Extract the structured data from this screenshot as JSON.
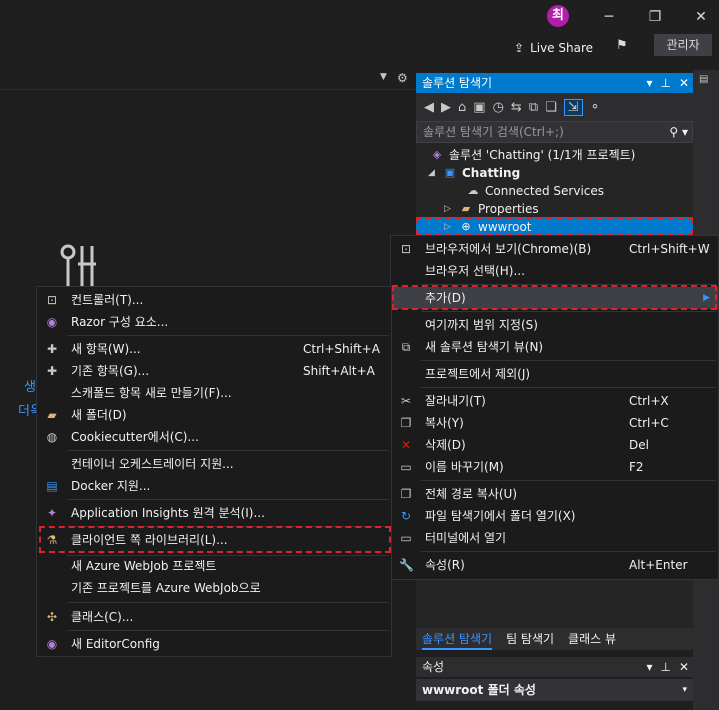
{
  "titlebar": {
    "avatar_initial": "최",
    "minimize": "─",
    "restore": "❐",
    "close": "✕",
    "live_share": "Live Share",
    "admin_button": "관리자"
  },
  "left_pane": {
    "blue_text_1": "생",
    "blue_text_2": "더욱"
  },
  "solution_explorer": {
    "title": "솔루션 탐색기",
    "search_placeholder": "솔루션 탐색기 검색(Ctrl+;)",
    "tree": {
      "solution": "솔루션 'Chatting' (1/1개 프로젝트)",
      "project": "Chatting",
      "connected_services": "Connected Services",
      "properties": "Properties",
      "wwwroot": "wwwroot"
    },
    "tabs": [
      "솔루션 탐색기",
      "팀 탐색기",
      "클래스 뷰"
    ]
  },
  "properties_panel": {
    "title": "속성",
    "selected_object": "wwwroot 폴더 속성"
  },
  "context_menu_right": {
    "items": [
      {
        "label": "브라우저에서 보기(Chrome)(B)",
        "shortcut": "Ctrl+Shift+W"
      },
      {
        "label": "브라우저 선택(H)...",
        "shortcut": ""
      },
      {
        "label": "추가(D)",
        "shortcut": ""
      },
      {
        "label": "여기까지 범위 지정(S)",
        "shortcut": ""
      },
      {
        "label": "새 솔루션 탐색기 뷰(N)",
        "shortcut": ""
      },
      {
        "label": "프로젝트에서 제외(J)",
        "shortcut": ""
      },
      {
        "label": "잘라내기(T)",
        "shortcut": "Ctrl+X"
      },
      {
        "label": "복사(Y)",
        "shortcut": "Ctrl+C"
      },
      {
        "label": "삭제(D)",
        "shortcut": "Del"
      },
      {
        "label": "이름 바꾸기(M)",
        "shortcut": "F2"
      },
      {
        "label": "전체 경로 복사(U)",
        "shortcut": ""
      },
      {
        "label": "파일 탐색기에서 폴더 열기(X)",
        "shortcut": ""
      },
      {
        "label": "터미널에서 열기",
        "shortcut": ""
      },
      {
        "label": "속성(R)",
        "shortcut": "Alt+Enter"
      }
    ]
  },
  "context_menu_left": {
    "items": [
      {
        "label": "컨트롤러(T)...",
        "shortcut": ""
      },
      {
        "label": "Razor 구성 요소...",
        "shortcut": ""
      },
      {
        "label": "새 항목(W)...",
        "shortcut": "Ctrl+Shift+A"
      },
      {
        "label": "기존 항목(G)...",
        "shortcut": "Shift+Alt+A"
      },
      {
        "label": "스캐폴드 항목 새로 만들기(F)...",
        "shortcut": ""
      },
      {
        "label": "새 폴더(D)",
        "shortcut": ""
      },
      {
        "label": "Cookiecutter에서(C)...",
        "shortcut": ""
      },
      {
        "label": "컨테이너 오케스트레이터 지원...",
        "shortcut": ""
      },
      {
        "label": "Docker 지원...",
        "shortcut": ""
      },
      {
        "label": "Application Insights 원격 분석(I)...",
        "shortcut": ""
      },
      {
        "label": "클라이언트 쪽 라이브러리(L)...",
        "shortcut": ""
      },
      {
        "label": "새 Azure WebJob 프로젝트",
        "shortcut": ""
      },
      {
        "label": "기존 프로젝트를 Azure WebJob으로",
        "shortcut": ""
      },
      {
        "label": "클래스(C)...",
        "shortcut": ""
      },
      {
        "label": "새 EditorConfig",
        "shortcut": ""
      }
    ]
  },
  "colors": {
    "accent": "#007acc",
    "highlight_dash": "#e0202a"
  }
}
